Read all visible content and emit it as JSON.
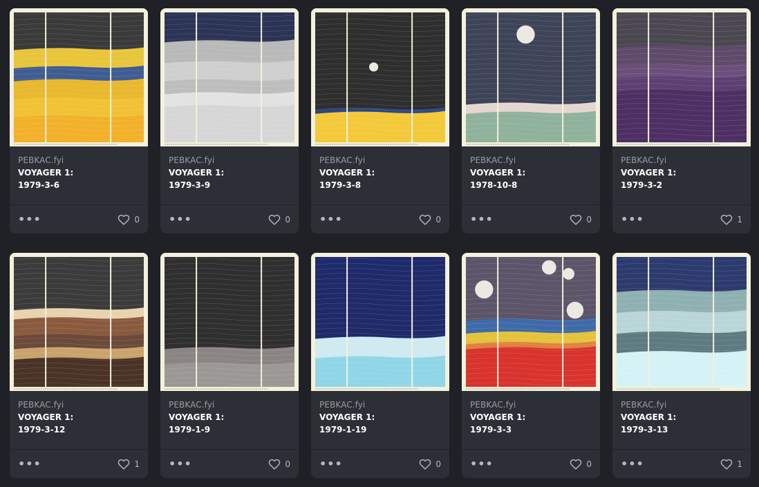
{
  "colors": {
    "page_bg": "#1f2126",
    "card_bg": "#2c2f36",
    "frame": "#f3f1dc"
  },
  "more_icon": "more-dots-icon",
  "like_icon": "heart-outline-icon",
  "cards": [
    {
      "brand": "PEBKAC.fyi",
      "title_line1": "VOYAGER 1:",
      "title_line2": "1979-3-6",
      "likes": "0",
      "art": {
        "bg": "#3a3a3a",
        "bands": [
          [
            "#e8c53a",
            0.28
          ],
          [
            "#3f5d92",
            0.42
          ],
          [
            "#e8b82e",
            0.52
          ],
          [
            "#f0c234",
            0.66
          ],
          [
            "#f2b12a",
            0.8
          ]
        ],
        "moons": []
      }
    },
    {
      "brand": "PEBKAC.fyi",
      "title_line1": "VOYAGER 1:",
      "title_line2": "1979-3-9",
      "likes": "0",
      "art": {
        "bg": "#2b3356",
        "bands": [
          [
            "#b9b9b9",
            0.22
          ],
          [
            "#cfcfcf",
            0.38
          ],
          [
            "#bdbdbd",
            0.52
          ],
          [
            "#e2e2e2",
            0.62
          ],
          [
            "#d6d6d6",
            0.72
          ]
        ],
        "moons": []
      }
    },
    {
      "brand": "PEBKAC.fyi",
      "title_line1": "VOYAGER 1:",
      "title_line2": "1979-3-8",
      "likes": "0",
      "art": {
        "bg": "#2e2e2e",
        "bands": [
          [
            "#2c4680",
            0.74
          ],
          [
            "#f3c93a",
            0.77
          ]
        ],
        "moons": [
          [
            0.45,
            0.42,
            0.035
          ]
        ]
      }
    },
    {
      "brand": "PEBKAC.fyi",
      "title_line1": "VOYAGER 1:",
      "title_line2": "1978-10-8",
      "likes": "0",
      "art": {
        "bg": "#3e4458",
        "bands": [
          [
            "#e5d6cf",
            0.7
          ],
          [
            "#8fb29c",
            0.77
          ]
        ],
        "moons": [
          [
            0.46,
            0.17,
            0.07
          ]
        ]
      }
    },
    {
      "brand": "PEBKAC.fyi",
      "title_line1": "VOYAGER 1:",
      "title_line2": "1979-3-2",
      "likes": "1",
      "art": {
        "bg": "#4a4750",
        "bands": [
          [
            "#5e4a6a",
            0.26
          ],
          [
            "#6a4f7b",
            0.4
          ],
          [
            "#5d3f72",
            0.5
          ],
          [
            "#4d2f63",
            0.6
          ]
        ],
        "moons": []
      }
    },
    {
      "brand": "PEBKAC.fyi",
      "title_line1": "VOYAGER 1:",
      "title_line2": "1979-3-12",
      "likes": "1",
      "art": {
        "bg": "#3b3b3b",
        "bands": [
          [
            "#e8d3ae",
            0.4
          ],
          [
            "#8a5a3f",
            0.47
          ],
          [
            "#6b4a3a",
            0.6
          ],
          [
            "#c9a36b",
            0.7
          ],
          [
            "#4a3326",
            0.78
          ]
        ],
        "moons": []
      }
    },
    {
      "brand": "PEBKAC.fyi",
      "title_line1": "VOYAGER 1:",
      "title_line2": "1979-1-9",
      "likes": "0",
      "art": {
        "bg": "#2f2f2f",
        "bands": [
          [
            "#8a8583",
            0.7
          ],
          [
            "#9a9795",
            0.82
          ]
        ],
        "moons": []
      }
    },
    {
      "brand": "PEBKAC.fyi",
      "title_line1": "VOYAGER 1:",
      "title_line2": "1979-1-19",
      "likes": "0",
      "art": {
        "bg": "#1f2a6b",
        "bands": [
          [
            "#cfeaf0",
            0.62
          ],
          [
            "#8fd6e8",
            0.77
          ]
        ],
        "moons": []
      }
    },
    {
      "brand": "PEBKAC.fyi",
      "title_line1": "VOYAGER 1:",
      "title_line2": "1979-3-3",
      "likes": "0",
      "art": {
        "bg": "#5c5468",
        "bands": [
          [
            "#3f6aa8",
            0.48
          ],
          [
            "#e5c23c",
            0.58
          ],
          [
            "#e08040",
            0.66
          ],
          [
            "#d8332c",
            0.7
          ]
        ],
        "moons": [
          [
            0.64,
            0.08,
            0.055
          ],
          [
            0.14,
            0.25,
            0.07
          ],
          [
            0.79,
            0.13,
            0.045
          ],
          [
            0.84,
            0.41,
            0.065
          ]
        ]
      }
    },
    {
      "brand": "PEBKAC.fyi",
      "title_line1": "VOYAGER 1:",
      "title_line2": "1979-3-13",
      "likes": "1",
      "art": {
        "bg": "#2c3a6e",
        "bands": [
          [
            "#8fb0b2",
            0.26
          ],
          [
            "#b8d6d8",
            0.42
          ],
          [
            "#5d7b80",
            0.58
          ],
          [
            "#d4f3f6",
            0.73
          ]
        ],
        "moons": []
      }
    }
  ]
}
